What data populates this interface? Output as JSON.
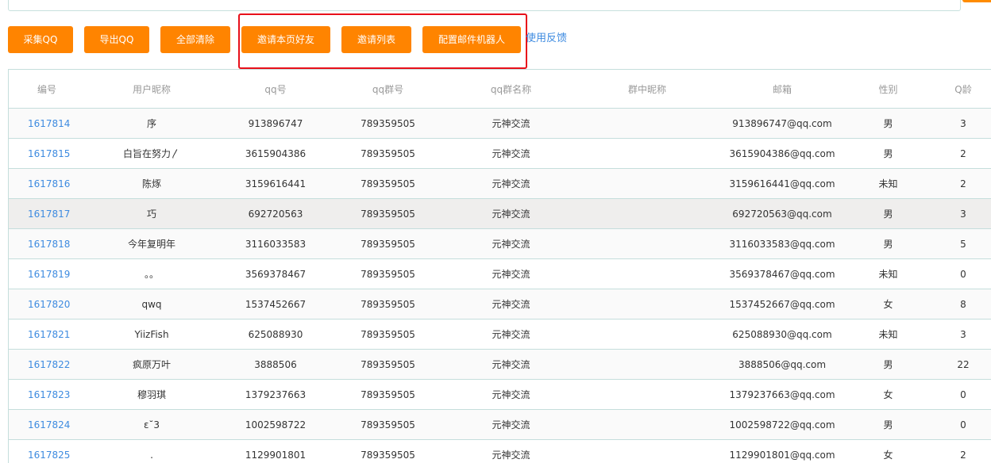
{
  "toolbar": {
    "collect_label": "采集QQ",
    "export_label": "导出QQ",
    "clear_label": "全部清除",
    "invite_page_label": "邀请本页好友",
    "invite_list_label": "邀请列表",
    "mail_robot_label": "配置邮件机器人",
    "feedback_label": "使用反馈"
  },
  "table": {
    "headers": [
      "编号",
      "用户昵称",
      "qq号",
      "qq群号",
      "qq群名称",
      "群中昵称",
      "邮箱",
      "性别",
      "Q龄"
    ],
    "rows": [
      [
        "1617814",
        "序",
        "913896747",
        "789359505",
        "元神交流",
        "",
        "913896747@qq.com",
        "男",
        "3"
      ],
      [
        "1617815",
        "白旨在努力〳",
        "3615904386",
        "789359505",
        "元神交流",
        "",
        "3615904386@qq.com",
        "男",
        "2"
      ],
      [
        "1617816",
        "陈烼",
        "3159616441",
        "789359505",
        "元神交流",
        "",
        "3159616441@qq.com",
        "未知",
        "2"
      ],
      [
        "1617817",
        "巧",
        "692720563",
        "789359505",
        "元神交流",
        "",
        "692720563@qq.com",
        "男",
        "3"
      ],
      [
        "1617818",
        "今年复明年",
        "3116033583",
        "789359505",
        "元神交流",
        "",
        "3116033583@qq.com",
        "男",
        "5"
      ],
      [
        "1617819",
        "。。",
        "3569378467",
        "789359505",
        "元神交流",
        "",
        "3569378467@qq.com",
        "未知",
        "0"
      ],
      [
        "1617820",
        "qwq",
        "1537452667",
        "789359505",
        "元神交流",
        "",
        "1537452667@qq.com",
        "女",
        "8"
      ],
      [
        "1617821",
        "YiizFish",
        "625088930",
        "789359505",
        "元神交流",
        "",
        "625088930@qq.com",
        "未知",
        "3"
      ],
      [
        "1617822",
        "疯原万叶",
        "3888506",
        "789359505",
        "元神交流",
        "",
        "3888506@qq.com",
        "男",
        "22"
      ],
      [
        "1617823",
        "穆羽琪",
        "1379237663",
        "789359505",
        "元神交流",
        "",
        "1379237663@qq.com",
        "女",
        "0"
      ],
      [
        "1617824",
        "ε˘3",
        "1002598722",
        "789359505",
        "元神交流",
        "",
        "1002598722@qq.com",
        "男",
        "0"
      ],
      [
        "1617825",
        ".",
        "1129901801",
        "789359505",
        "元神交流",
        "",
        "1129901801@qq.com",
        "女",
        "2"
      ]
    ]
  },
  "colors": {
    "accent": "#ff8400",
    "highlight_border": "#e8101a",
    "link": "#3e8be0"
  }
}
